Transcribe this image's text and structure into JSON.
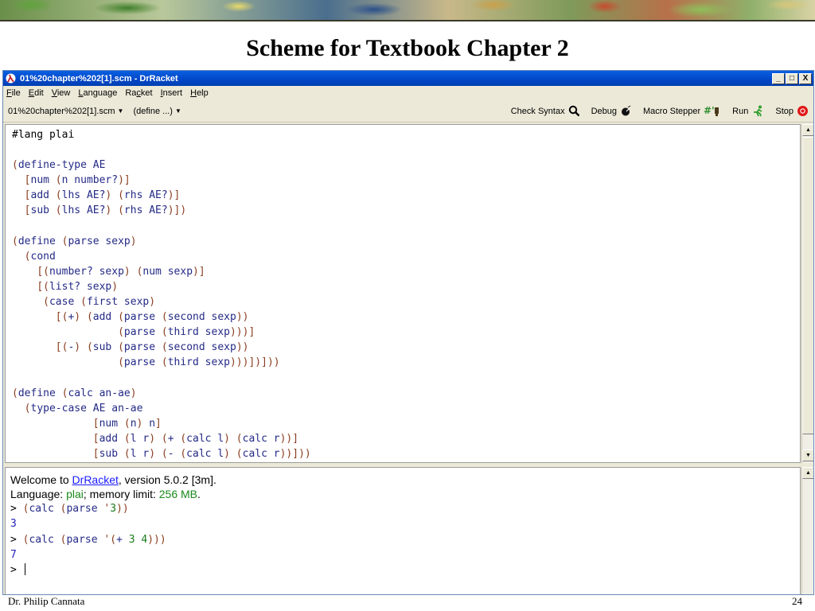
{
  "slide": {
    "title": "Scheme for Textbook Chapter 2",
    "footer_left": "Dr. Philip Cannata",
    "footer_right": "24"
  },
  "window": {
    "title": "01%20chapter%202[1].scm - DrRacket",
    "controls": [
      "_",
      "□",
      "X"
    ]
  },
  "menu": {
    "items": [
      {
        "label": "File",
        "underline": "F",
        "rest": "ile"
      },
      {
        "label": "Edit",
        "underline": "E",
        "rest": "dit"
      },
      {
        "label": "View",
        "underline": "V",
        "rest": "iew"
      },
      {
        "label": "Language",
        "underline": "L",
        "rest": "anguage"
      },
      {
        "label": "Racket",
        "pre": "Ra",
        "underline": "c",
        "rest": "ket"
      },
      {
        "label": "Insert",
        "underline": "I",
        "rest": "nsert"
      },
      {
        "label": "Help",
        "underline": "H",
        "rest": "elp"
      }
    ]
  },
  "toolbar": {
    "file_dropdown": "01%20chapter%202[1].scm",
    "define_dropdown": "(define ...)",
    "check_syntax": "Check Syntax",
    "debug": "Debug",
    "macro_stepper": "Macro Stepper",
    "run": "Run",
    "stop": "Stop"
  },
  "definitions": {
    "lines": [
      "#lang plai",
      "",
      "(define-type AE",
      "  [num (n number?)]",
      "  [add (lhs AE?) (rhs AE?)]",
      "  [sub (lhs AE?) (rhs AE?)])",
      "",
      "(define (parse sexp)",
      "  (cond",
      "    [(number? sexp) (num sexp)]",
      "    [(list? sexp)",
      "     (case (first sexp)",
      "       [(+) (add (parse (second sexp))",
      "                 (parse (third sexp)))]",
      "       [(-) (sub (parse (second sexp))",
      "                 (parse (third sexp)))])]))",
      "",
      "(define (calc an-ae)",
      "  (type-case AE an-ae",
      "             [num (n) n]",
      "             [add (l r) (+ (calc l) (calc r))]",
      "             [sub (l r) (- (calc l) (calc r))]))"
    ]
  },
  "interactions": {
    "welcome_prefix": "Welcome to ",
    "welcome_link": "DrRacket",
    "welcome_suffix": ", version 5.0.2 [3m].",
    "language_prefix": "Language: ",
    "language_name": "plai",
    "memory_prefix": "; memory limit: ",
    "memory_value": "256 MB",
    "memory_suffix": ".",
    "prompt": ">",
    "expr1": "(calc (parse '3))",
    "result1": "3",
    "expr2": "(calc (parse '(+ 3 4)))",
    "result2": "7"
  }
}
